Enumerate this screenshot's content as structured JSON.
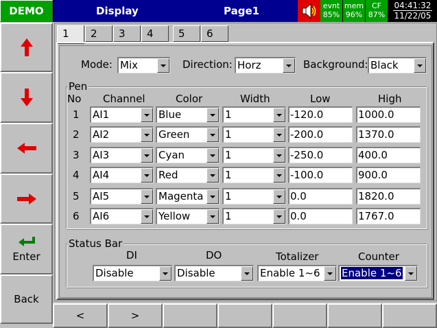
{
  "header": {
    "demo": "DEMO",
    "title": "Display",
    "page": "Page1",
    "stats": [
      {
        "label": "evnt",
        "value": "85%"
      },
      {
        "label": "mem",
        "value": "96%"
      },
      {
        "label": "CF",
        "value": "87%"
      }
    ],
    "time": "04:41:32",
    "date": "11/22/05"
  },
  "sidebar": {
    "enter": "Enter",
    "back": "Back"
  },
  "tabs": [
    "1",
    "2",
    "3",
    "4",
    "5",
    "6"
  ],
  "settings": {
    "mode_label": "Mode:",
    "mode_value": "Mix",
    "direction_label": "Direction:",
    "direction_value": "Horz",
    "background_label": "Background:",
    "background_value": "Black"
  },
  "pen": {
    "title": "Pen",
    "headers": [
      "No",
      "Channel",
      "Color",
      "Width",
      "Low",
      "High"
    ],
    "rows": [
      {
        "no": "1",
        "channel": "AI1",
        "color": "Blue",
        "width": "1",
        "low": "-120.0",
        "high": "1000.0"
      },
      {
        "no": "2",
        "channel": "AI2",
        "color": "Green",
        "width": "1",
        "low": "-200.0",
        "high": "1370.0"
      },
      {
        "no": "3",
        "channel": "AI3",
        "color": "Cyan",
        "width": "1",
        "low": "-250.0",
        "high": "400.0"
      },
      {
        "no": "4",
        "channel": "AI4",
        "color": "Red",
        "width": "1",
        "low": "-100.0",
        "high": "900.0"
      },
      {
        "no": "5",
        "channel": "AI5",
        "color": "Magenta",
        "width": "1",
        "low": "0.0",
        "high": "1820.0"
      },
      {
        "no": "6",
        "channel": "AI6",
        "color": "Yellow",
        "width": "1",
        "low": "0.0",
        "high": "1767.0"
      }
    ]
  },
  "status_bar": {
    "title": "Status Bar",
    "di_label": "DI",
    "di_value": "Disable",
    "do_label": "DO",
    "do_value": "Disable",
    "totalizer_label": "Totalizer",
    "totalizer_value": "Enable 1~6",
    "counter_label": "Counter",
    "counter_value": "Enable 1~6"
  },
  "bottom": {
    "prev": "<",
    "next": ">"
  },
  "colors": {
    "demo_bg": "#00a000",
    "title_bg": "#000090",
    "alarm_red": "#e00000",
    "arrow_red": "#e00000",
    "enter_green": "#008000",
    "selection_blue": "#000080"
  }
}
